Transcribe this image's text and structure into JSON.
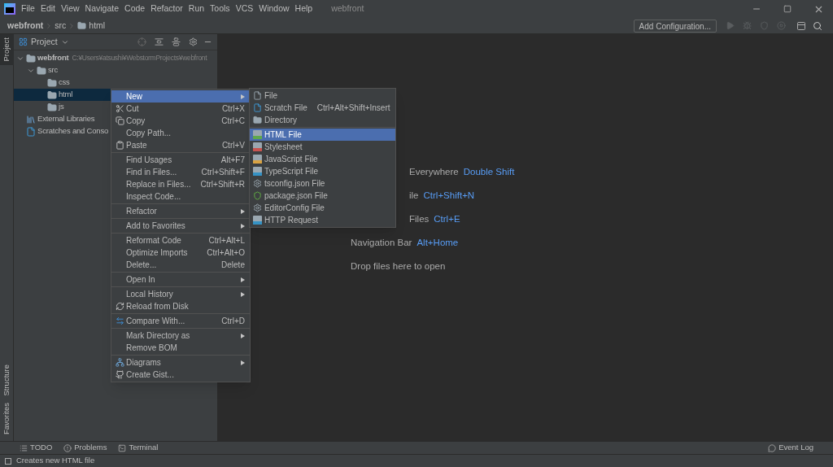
{
  "menu_bar": {
    "items": [
      "File",
      "Edit",
      "View",
      "Navigate",
      "Code",
      "Refactor",
      "Run",
      "Tools",
      "VCS",
      "Window",
      "Help"
    ],
    "project_name": "webfront"
  },
  "breadcrumbs": [
    {
      "label": "webfront",
      "kind": "plain"
    },
    {
      "label": "src",
      "kind": "plain"
    },
    {
      "label": "html",
      "kind": "folder"
    }
  ],
  "toolbar": {
    "run_configuration": "Add Configuration..."
  },
  "left_strip": {
    "top": [
      {
        "label": "Project",
        "selected": true
      }
    ],
    "bottom": [
      {
        "label": "Structure",
        "selected": false
      },
      {
        "label": "Favorites",
        "selected": false
      }
    ]
  },
  "project_panel": {
    "title": "Project",
    "tree": [
      {
        "label": "webfront",
        "path": "C:¥Users¥atsushi¥WebstormProjects¥webfront",
        "kind": "folder",
        "expanded": true,
        "selected": false,
        "children": [
          {
            "label": "src",
            "kind": "folder",
            "expanded": true,
            "selected": false,
            "children": [
              {
                "label": "css",
                "kind": "folder",
                "selected": false
              },
              {
                "label": "html",
                "kind": "folder",
                "selected": true
              },
              {
                "label": "js",
                "kind": "folder",
                "selected": false
              }
            ]
          }
        ]
      },
      {
        "label": "External Libraries",
        "kind": "libraries",
        "selected": false
      },
      {
        "label": "Scratches and Conso",
        "kind": "scratches",
        "selected": false
      }
    ]
  },
  "context_menu": {
    "groups": [
      [
        {
          "label": "New",
          "submenu": true,
          "selected": true
        },
        {
          "label": "Cut",
          "shortcut": "Ctrl+X",
          "kind": "scissors",
          "selected": false
        },
        {
          "label": "Copy",
          "shortcut": "Ctrl+C",
          "kind": "copy",
          "selected": false
        },
        {
          "label": "Copy Path...",
          "selected": false
        },
        {
          "label": "Paste",
          "shortcut": "Ctrl+V",
          "kind": "paste",
          "selected": false
        }
      ],
      [
        {
          "label": "Find Usages",
          "shortcut": "Alt+F7",
          "selected": false
        },
        {
          "label": "Find in Files...",
          "shortcut": "Ctrl+Shift+F",
          "selected": false
        },
        {
          "label": "Replace in Files...",
          "shortcut": "Ctrl+Shift+R",
          "selected": false
        },
        {
          "label": "Inspect Code...",
          "selected": false
        }
      ],
      [
        {
          "label": "Refactor",
          "submenu": true,
          "selected": false
        }
      ],
      [
        {
          "label": "Add to Favorites",
          "submenu": true,
          "selected": false
        }
      ],
      [
        {
          "label": "Reformat Code",
          "shortcut": "Ctrl+Alt+L",
          "selected": false
        },
        {
          "label": "Optimize Imports",
          "shortcut": "Ctrl+Alt+O",
          "selected": false
        },
        {
          "label": "Delete...",
          "shortcut": "Delete",
          "selected": false
        }
      ],
      [
        {
          "label": "Open In",
          "submenu": true,
          "selected": false
        }
      ],
      [
        {
          "label": "Local History",
          "submenu": true,
          "selected": false
        },
        {
          "label": "Reload from Disk",
          "kind": "reload",
          "selected": false
        }
      ],
      [
        {
          "label": "Compare With...",
          "shortcut": "Ctrl+D",
          "kind": "compare",
          "selected": false
        }
      ],
      [
        {
          "label": "Mark Directory as",
          "submenu": true,
          "selected": false
        },
        {
          "label": "Remove BOM",
          "selected": false
        }
      ],
      [
        {
          "label": "Diagrams",
          "submenu": true,
          "kind": "diagram",
          "selected": false
        },
        {
          "label": "Create Gist...",
          "kind": "github",
          "selected": false
        }
      ]
    ]
  },
  "new_submenu": {
    "groups": [
      [
        {
          "label": "File",
          "kind": "file",
          "selected": false
        },
        {
          "label": "Scratch File",
          "shortcut": "Ctrl+Alt+Shift+Insert",
          "kind": "scratch",
          "selected": false
        },
        {
          "label": "Directory",
          "kind": "folder",
          "selected": false
        }
      ],
      [
        {
          "label": "HTML File",
          "kind": "html",
          "selected": true
        },
        {
          "label": "Stylesheet",
          "kind": "css",
          "selected": false
        },
        {
          "label": "JavaScript File",
          "kind": "js",
          "selected": false
        },
        {
          "label": "TypeScript File",
          "kind": "ts",
          "selected": false
        },
        {
          "label": "tsconfig.json File",
          "kind": "tsconfig",
          "selected": false
        },
        {
          "label": "package.json File",
          "kind": "package",
          "selected": false
        },
        {
          "label": "EditorConfig File",
          "kind": "gear",
          "selected": false
        },
        {
          "label": "HTTP Request",
          "kind": "api",
          "selected": false
        }
      ]
    ]
  },
  "editor_hints": [
    {
      "label": "Everywhere",
      "shortcut": "Double Shift",
      "partial": true
    },
    {
      "label": "ile",
      "shortcut": "Ctrl+Shift+N",
      "partial": true
    },
    {
      "label": "Files",
      "shortcut": "Ctrl+E",
      "partial": true
    },
    {
      "label": "Navigation Bar",
      "shortcut": "Alt+Home",
      "partial": false
    },
    {
      "label": "Drop files here to open",
      "partial": false
    }
  ],
  "bottom_tabs": [
    {
      "label": "TODO",
      "kind": "list"
    },
    {
      "label": "Problems",
      "kind": "problems"
    },
    {
      "label": "Terminal",
      "kind": "terminal"
    }
  ],
  "event_log": "Event Log",
  "status_bar": "Creates new HTML file"
}
